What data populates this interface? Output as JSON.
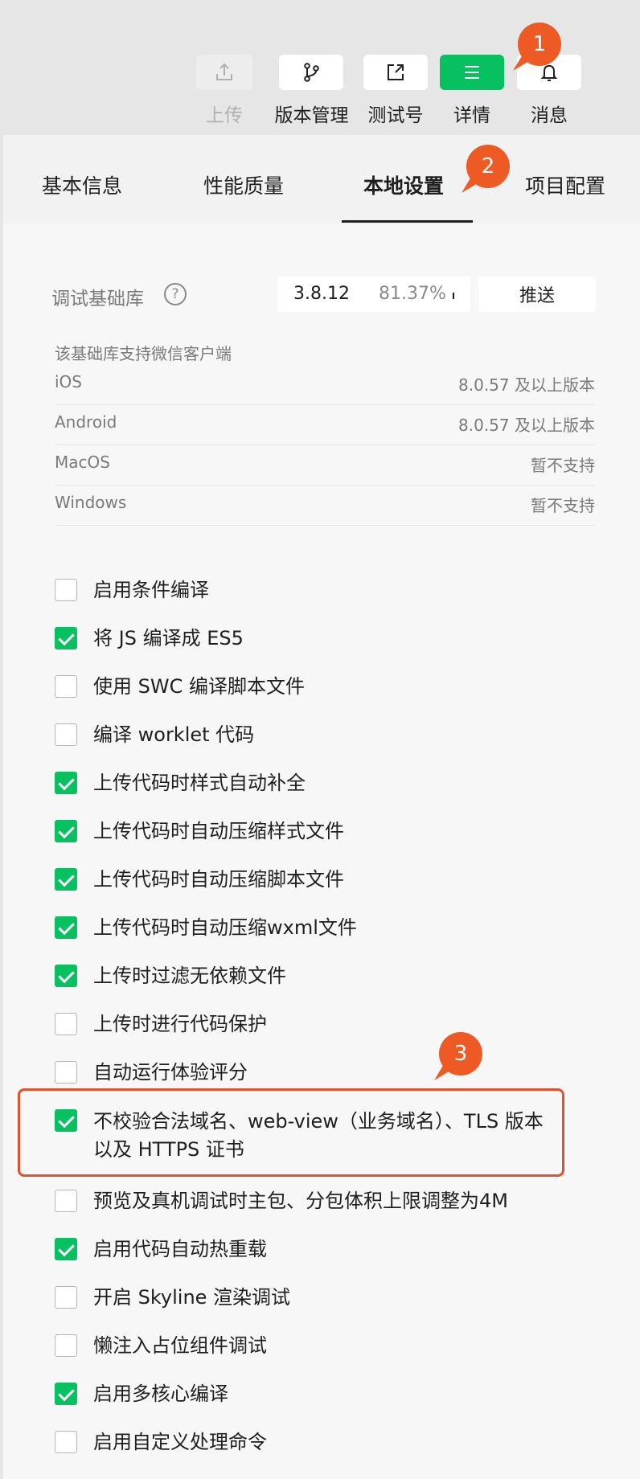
{
  "toolbar": {
    "buttons": [
      {
        "label": "上传",
        "icon": "upload-icon",
        "state": "disabled"
      },
      {
        "label": "版本管理",
        "icon": "branch-icon",
        "state": "normal"
      },
      {
        "label": "测试号",
        "icon": "external-link-icon",
        "state": "normal"
      },
      {
        "label": "详情",
        "icon": "menu-icon",
        "state": "active"
      },
      {
        "label": "消息",
        "icon": "bell-icon",
        "state": "normal"
      }
    ]
  },
  "annotations": [
    "1",
    "2",
    "3"
  ],
  "tabs": [
    {
      "label": "基本信息",
      "active": false
    },
    {
      "label": "性能质量",
      "active": false
    },
    {
      "label": "本地设置",
      "active": true
    },
    {
      "label": "项目配置",
      "active": false
    }
  ],
  "debug_lib": {
    "label": "调试基础库",
    "version": "3.8.12",
    "percent": "81.37%",
    "push_label": "推送"
  },
  "support": {
    "title": "该基础库支持微信客户端",
    "rows": [
      {
        "name": "iOS",
        "value": "8.0.57 及以上版本"
      },
      {
        "name": "Android",
        "value": "8.0.57 及以上版本"
      },
      {
        "name": "MacOS",
        "value": "暂不支持"
      },
      {
        "name": "Windows",
        "value": "暂不支持"
      }
    ]
  },
  "options": [
    {
      "label": "启用条件编译",
      "checked": false
    },
    {
      "label": "将 JS 编译成 ES5",
      "checked": true
    },
    {
      "label": "使用 SWC 编译脚本文件",
      "checked": false
    },
    {
      "label": "编译 worklet 代码",
      "checked": false
    },
    {
      "label": "上传代码时样式自动补全",
      "checked": true
    },
    {
      "label": "上传代码时自动压缩样式文件",
      "checked": true
    },
    {
      "label": "上传代码时自动压缩脚本文件",
      "checked": true
    },
    {
      "label": "上传代码时自动压缩wxml文件",
      "checked": true
    },
    {
      "label": "上传时过滤无依赖文件",
      "checked": true
    },
    {
      "label": "上传时进行代码保护",
      "checked": false
    },
    {
      "label": "自动运行体验评分",
      "checked": false
    },
    {
      "label": "不校验合法域名、web-view（业务域名）、TLS 版本以及 HTTPS 证书",
      "checked": true
    },
    {
      "label": "预览及真机调试时主包、分包体积上限调整为4M",
      "checked": false
    },
    {
      "label": "启用代码自动热重载",
      "checked": true
    },
    {
      "label": "开启 Skyline 渲染调试",
      "checked": false
    },
    {
      "label": "懒注入占位组件调试",
      "checked": false
    },
    {
      "label": "启用多核心编译",
      "checked": true
    },
    {
      "label": "启用自定义处理命令",
      "checked": false
    }
  ],
  "colors": {
    "accent": "#07c160",
    "annotation": "#ee5a24"
  }
}
